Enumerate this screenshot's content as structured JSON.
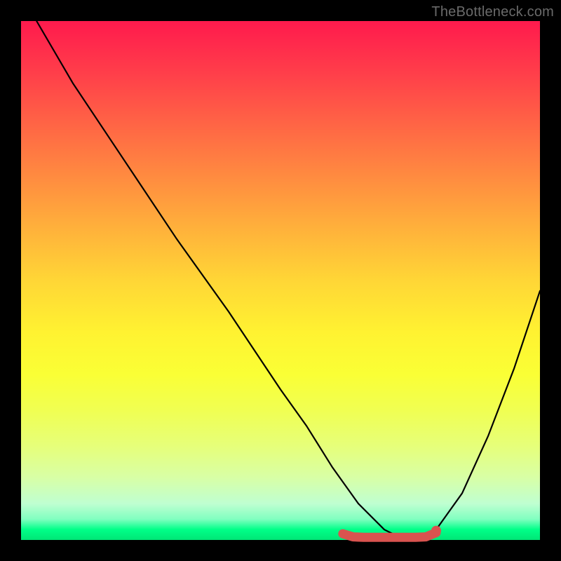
{
  "watermark": "TheBottleneck.com",
  "chart_data": {
    "type": "line",
    "title": "",
    "xlabel": "",
    "ylabel": "",
    "xlim": [
      0,
      100
    ],
    "ylim": [
      0,
      100
    ],
    "grid": false,
    "legend": false,
    "annotations": [],
    "series": [
      {
        "name": "bottleneck-curve",
        "color": "#000000",
        "x": [
          3,
          10,
          20,
          30,
          40,
          50,
          55,
          60,
          65,
          70,
          73,
          76,
          80,
          85,
          90,
          95,
          100
        ],
        "y": [
          100,
          88,
          73,
          58,
          44,
          29,
          22,
          14,
          7,
          2,
          0.5,
          0.5,
          2,
          9,
          20,
          33,
          48
        ]
      },
      {
        "name": "optimal-zone",
        "color": "#d9534f",
        "style": "thick-rounded",
        "x": [
          62,
          64,
          66,
          68,
          70,
          72,
          74,
          76,
          78,
          80
        ],
        "y": [
          1.2,
          0.6,
          0.5,
          0.5,
          0.5,
          0.5,
          0.5,
          0.5,
          0.6,
          1.4
        ]
      }
    ],
    "marker": {
      "name": "optimal-point",
      "color": "#d9534f",
      "x": 80,
      "y": 1.8
    }
  }
}
